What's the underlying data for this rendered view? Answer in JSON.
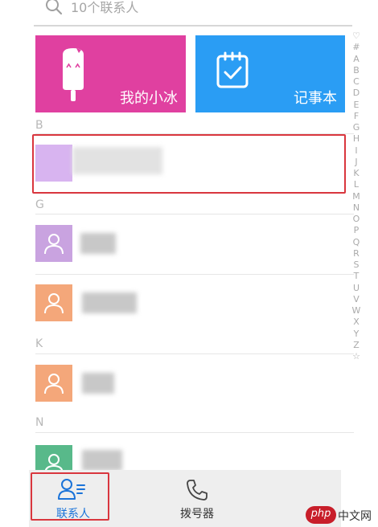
{
  "search": {
    "placeholder": "10个联系人"
  },
  "tiles": [
    {
      "label": "我的小冰",
      "color": "#e040a0"
    },
    {
      "label": "记事本",
      "color": "#2a9df4"
    }
  ],
  "sections": [
    {
      "letter": "B"
    },
    {
      "letter": "G"
    },
    {
      "letter": "K"
    },
    {
      "letter": "N"
    }
  ],
  "avatar_colors": {
    "highlighted": "#d8b4f0",
    "purple": "#c9a3e0",
    "orange": "#f4a77a",
    "green": "#58b98a"
  },
  "alphabet_index": [
    "♡",
    "#",
    "A",
    "B",
    "C",
    "D",
    "E",
    "F",
    "G",
    "H",
    "I",
    "J",
    "K",
    "L",
    "M",
    "N",
    "O",
    "P",
    "Q",
    "R",
    "S",
    "T",
    "U",
    "V",
    "W",
    "X",
    "Y",
    "Z",
    "☆"
  ],
  "bottom_nav": {
    "contacts_label": "联系人",
    "dialer_label": "拨号器",
    "active_color": "#1a73d9"
  },
  "watermark": {
    "logo": "php",
    "text": "中文网"
  },
  "highlight_color": "#d9363e"
}
